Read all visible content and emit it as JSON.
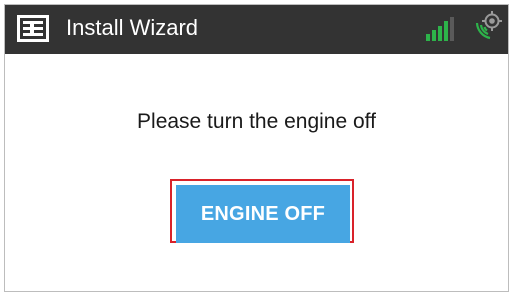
{
  "header": {
    "title": "Install Wizard",
    "logo_icon": "brand-logo-icon",
    "signal_icon": "signal-strength-icon",
    "gps_icon": "gps-location-icon",
    "signal_color": "#2db34a"
  },
  "main": {
    "prompt": "Please turn the engine off",
    "engine_button_label": "ENGINE OFF",
    "button_color": "#47a6e3",
    "highlight_color": "#d9222a"
  }
}
